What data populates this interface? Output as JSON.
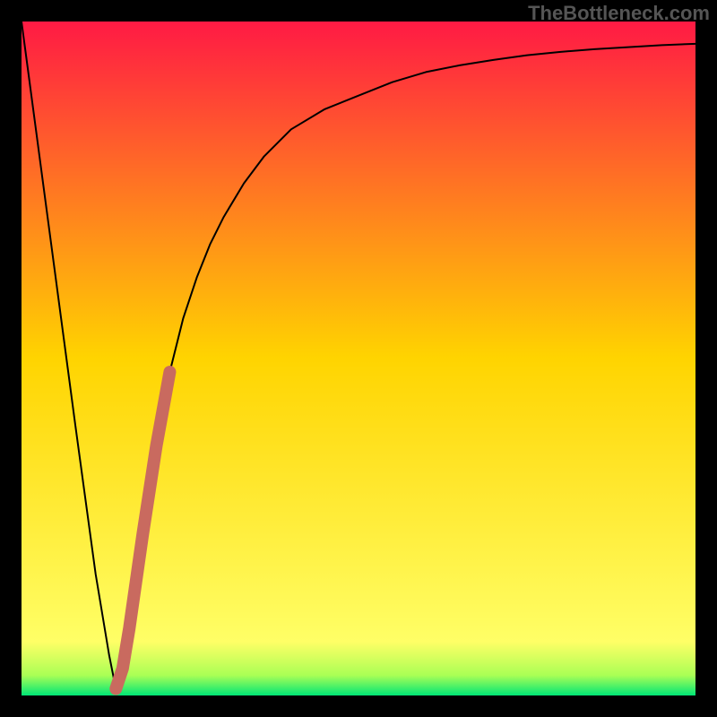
{
  "watermark": "TheBottleneck.com",
  "chart_data": {
    "type": "line",
    "title": "",
    "xlabel": "",
    "ylabel": "",
    "xlim": [
      0,
      100
    ],
    "ylim": [
      0,
      100
    ],
    "grid": false,
    "legend": false,
    "gradient_stops": [
      {
        "offset": 0,
        "color": "#ff1a44"
      },
      {
        "offset": 50,
        "color": "#ffd400"
      },
      {
        "offset": 92,
        "color": "#ffff66"
      },
      {
        "offset": 97,
        "color": "#aaff55"
      },
      {
        "offset": 100,
        "color": "#00e676"
      }
    ],
    "series": [
      {
        "name": "bottleneck-curve",
        "color": "#000000",
        "stroke_width": 2,
        "x": [
          0,
          4,
          8,
          11,
          13,
          14,
          15,
          16,
          18,
          20,
          22,
          24,
          26,
          28,
          30,
          33,
          36,
          40,
          45,
          50,
          55,
          60,
          65,
          70,
          75,
          80,
          85,
          90,
          95,
          100
        ],
        "values": [
          100,
          70,
          40,
          18,
          6,
          1,
          4,
          10,
          24,
          37,
          48,
          56,
          62,
          67,
          71,
          76,
          80,
          84,
          87,
          89,
          91,
          92.5,
          93.5,
          94.3,
          95,
          95.5,
          95.9,
          96.2,
          96.5,
          96.7
        ]
      },
      {
        "name": "highlight-segment",
        "color": "#c96a5f",
        "stroke_width": 14,
        "x": [
          14,
          15,
          16,
          18,
          20,
          22
        ],
        "values": [
          1,
          4,
          10,
          24,
          37,
          48
        ]
      }
    ]
  }
}
